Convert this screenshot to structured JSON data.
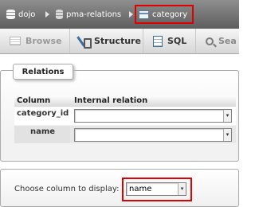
{
  "breadcrumb": {
    "server": "dojo",
    "database": "pma-relations",
    "table": "category",
    "highlight_color": "#e00000"
  },
  "tabs": [
    {
      "label": "Browse",
      "icon": "browse-icon"
    },
    {
      "label": "Structure",
      "icon": "structure-icon"
    },
    {
      "label": "SQL",
      "icon": "sql-icon"
    },
    {
      "label": "Sea",
      "icon": "search-icon"
    }
  ],
  "relations": {
    "legend": "Relations",
    "headers": {
      "column": "Column",
      "internal_relation": "Internal relation"
    },
    "rows": [
      {
        "column": "category_id",
        "relation_value": ""
      },
      {
        "column": "name",
        "relation_value": ""
      }
    ]
  },
  "display": {
    "label": "Choose column to display:",
    "selected": "name"
  }
}
